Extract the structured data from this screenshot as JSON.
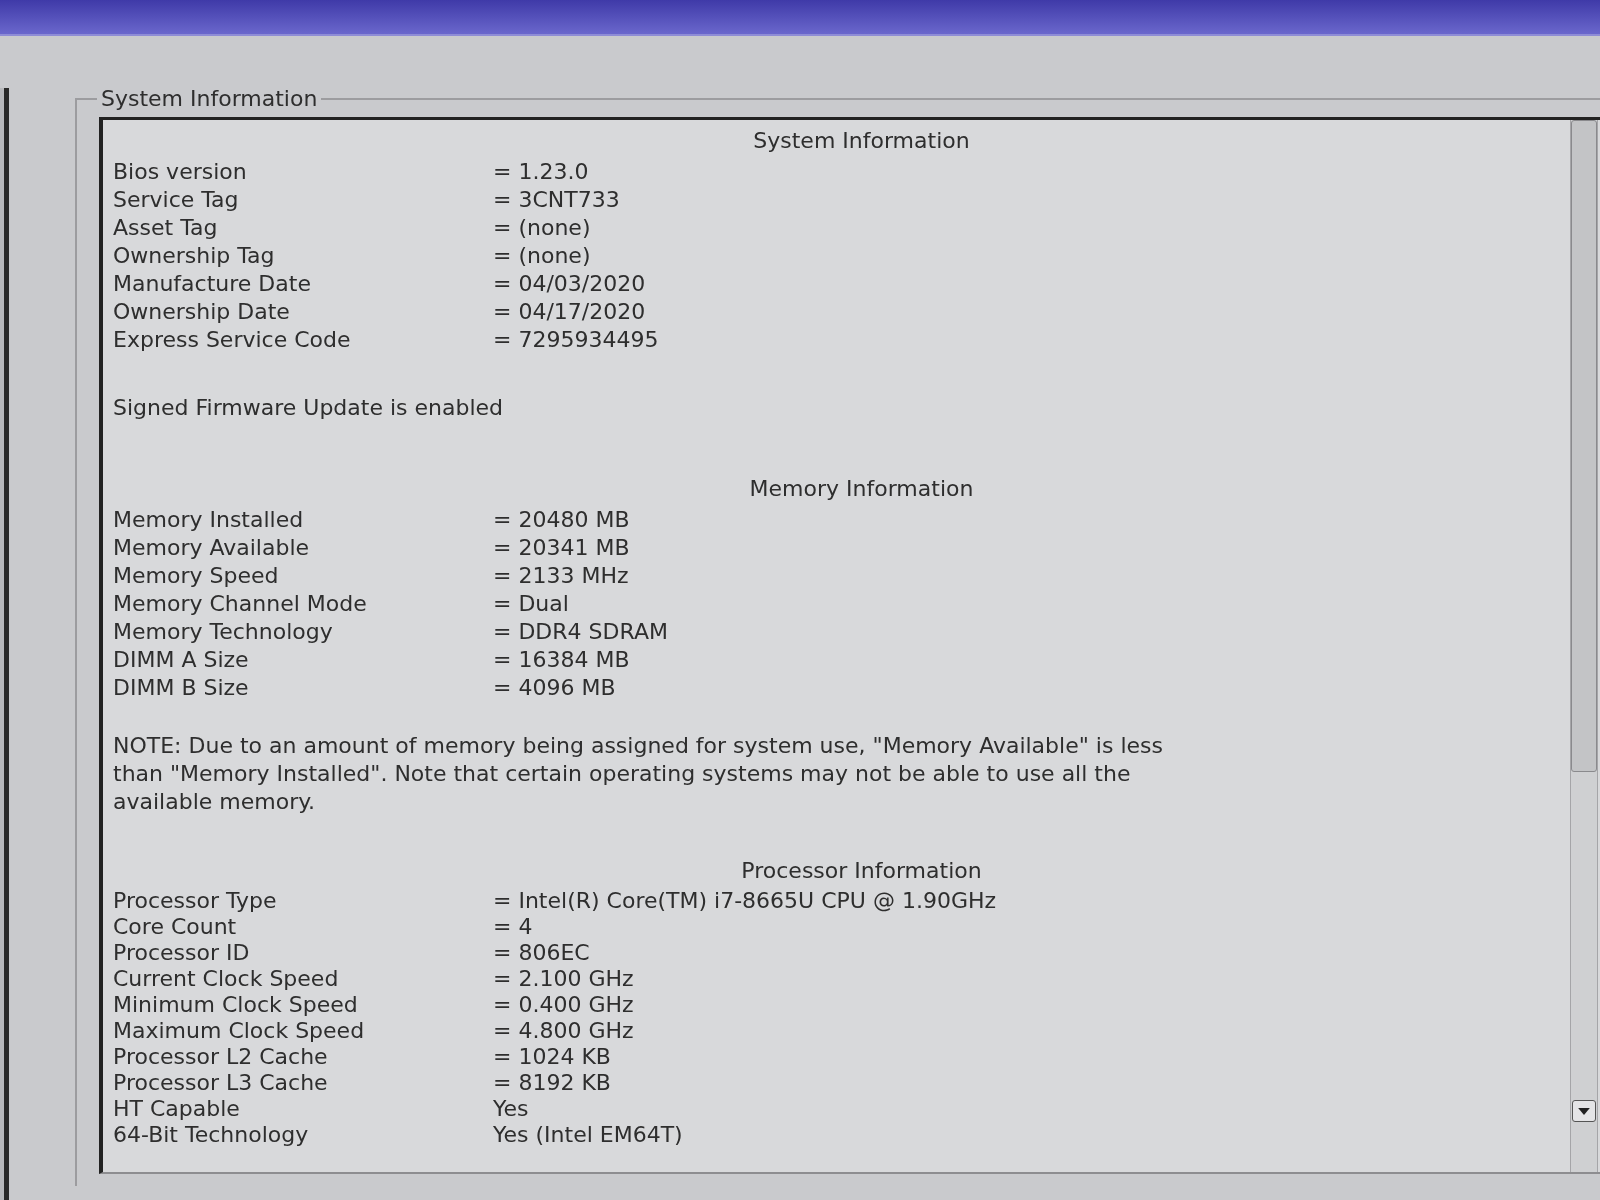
{
  "group_box": {
    "title": "System Information"
  },
  "sections": [
    {
      "heading": "System Information",
      "rows": [
        {
          "label": "Bios version",
          "value": "= 1.23.0"
        },
        {
          "label": "Service Tag",
          "value": "= 3CNT733"
        },
        {
          "label": "Asset Tag",
          "value": "= (none)"
        },
        {
          "label": "Ownership Tag",
          "value": "= (none)"
        },
        {
          "label": "Manufacture Date",
          "value": "= 04/03/2020"
        },
        {
          "label": "Ownership Date",
          "value": "= 04/17/2020"
        },
        {
          "label": "Express Service Code",
          "value": "= 7295934495"
        }
      ],
      "note": "Signed Firmware Update is enabled"
    },
    {
      "heading": "Memory Information",
      "rows": [
        {
          "label": "Memory Installed",
          "value": "= 20480 MB"
        },
        {
          "label": "Memory Available",
          "value": "= 20341 MB"
        },
        {
          "label": "Memory Speed",
          "value": "= 2133 MHz"
        },
        {
          "label": "Memory Channel Mode",
          "value": "= Dual"
        },
        {
          "label": "Memory Technology",
          "value": "= DDR4 SDRAM"
        },
        {
          "label": "DIMM A Size",
          "value": "= 16384 MB"
        },
        {
          "label": "DIMM B Size",
          "value": "= 4096 MB"
        }
      ],
      "note": "NOTE: Due to an amount of memory being assigned for system use, \"Memory Available\" is less than \"Memory Installed\". Note that certain operating systems may not be able to use all the available memory."
    },
    {
      "heading": "Processor Information",
      "rows": [
        {
          "label": "Processor Type",
          "value": "= Intel(R) Core(TM) i7-8665U CPU @ 1.90GHz"
        },
        {
          "label": "Core Count",
          "value": "= 4"
        },
        {
          "label": "Processor ID",
          "value": "= 806EC"
        },
        {
          "label": "Current Clock Speed",
          "value": "= 2.100 GHz"
        },
        {
          "label": "Minimum Clock Speed",
          "value": "= 0.400 GHz"
        },
        {
          "label": "Maximum Clock Speed",
          "value": "= 4.800 GHz"
        },
        {
          "label": "Processor L2 Cache",
          "value": "= 1024 KB"
        },
        {
          "label": "Processor L3 Cache",
          "value": "= 8192 KB"
        },
        {
          "label": "HT Capable",
          "value": "Yes"
        },
        {
          "label": "64-Bit Technology",
          "value": "Yes (Intel EM64T)"
        }
      ]
    }
  ]
}
